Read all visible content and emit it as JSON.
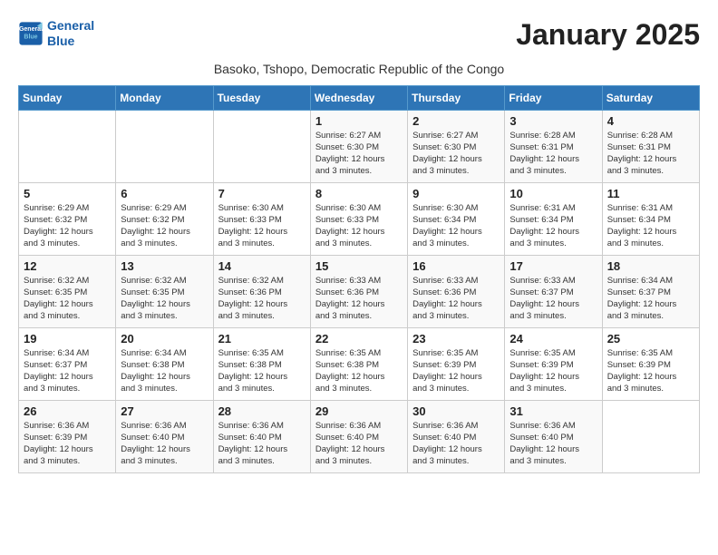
{
  "logo": {
    "line1": "General",
    "line2": "Blue"
  },
  "title": "January 2025",
  "subtitle": "Basoko, Tshopo, Democratic Republic of the Congo",
  "days_of_week": [
    "Sunday",
    "Monday",
    "Tuesday",
    "Wednesday",
    "Thursday",
    "Friday",
    "Saturday"
  ],
  "weeks": [
    [
      {
        "day": "",
        "info": ""
      },
      {
        "day": "",
        "info": ""
      },
      {
        "day": "",
        "info": ""
      },
      {
        "day": "1",
        "info": "Sunrise: 6:27 AM\nSunset: 6:30 PM\nDaylight: 12 hours\nand 3 minutes."
      },
      {
        "day": "2",
        "info": "Sunrise: 6:27 AM\nSunset: 6:30 PM\nDaylight: 12 hours\nand 3 minutes."
      },
      {
        "day": "3",
        "info": "Sunrise: 6:28 AM\nSunset: 6:31 PM\nDaylight: 12 hours\nand 3 minutes."
      },
      {
        "day": "4",
        "info": "Sunrise: 6:28 AM\nSunset: 6:31 PM\nDaylight: 12 hours\nand 3 minutes."
      }
    ],
    [
      {
        "day": "5",
        "info": "Sunrise: 6:29 AM\nSunset: 6:32 PM\nDaylight: 12 hours\nand 3 minutes."
      },
      {
        "day": "6",
        "info": "Sunrise: 6:29 AM\nSunset: 6:32 PM\nDaylight: 12 hours\nand 3 minutes."
      },
      {
        "day": "7",
        "info": "Sunrise: 6:30 AM\nSunset: 6:33 PM\nDaylight: 12 hours\nand 3 minutes."
      },
      {
        "day": "8",
        "info": "Sunrise: 6:30 AM\nSunset: 6:33 PM\nDaylight: 12 hours\nand 3 minutes."
      },
      {
        "day": "9",
        "info": "Sunrise: 6:30 AM\nSunset: 6:34 PM\nDaylight: 12 hours\nand 3 minutes."
      },
      {
        "day": "10",
        "info": "Sunrise: 6:31 AM\nSunset: 6:34 PM\nDaylight: 12 hours\nand 3 minutes."
      },
      {
        "day": "11",
        "info": "Sunrise: 6:31 AM\nSunset: 6:34 PM\nDaylight: 12 hours\nand 3 minutes."
      }
    ],
    [
      {
        "day": "12",
        "info": "Sunrise: 6:32 AM\nSunset: 6:35 PM\nDaylight: 12 hours\nand 3 minutes."
      },
      {
        "day": "13",
        "info": "Sunrise: 6:32 AM\nSunset: 6:35 PM\nDaylight: 12 hours\nand 3 minutes."
      },
      {
        "day": "14",
        "info": "Sunrise: 6:32 AM\nSunset: 6:36 PM\nDaylight: 12 hours\nand 3 minutes."
      },
      {
        "day": "15",
        "info": "Sunrise: 6:33 AM\nSunset: 6:36 PM\nDaylight: 12 hours\nand 3 minutes."
      },
      {
        "day": "16",
        "info": "Sunrise: 6:33 AM\nSunset: 6:36 PM\nDaylight: 12 hours\nand 3 minutes."
      },
      {
        "day": "17",
        "info": "Sunrise: 6:33 AM\nSunset: 6:37 PM\nDaylight: 12 hours\nand 3 minutes."
      },
      {
        "day": "18",
        "info": "Sunrise: 6:34 AM\nSunset: 6:37 PM\nDaylight: 12 hours\nand 3 minutes."
      }
    ],
    [
      {
        "day": "19",
        "info": "Sunrise: 6:34 AM\nSunset: 6:37 PM\nDaylight: 12 hours\nand 3 minutes."
      },
      {
        "day": "20",
        "info": "Sunrise: 6:34 AM\nSunset: 6:38 PM\nDaylight: 12 hours\nand 3 minutes."
      },
      {
        "day": "21",
        "info": "Sunrise: 6:35 AM\nSunset: 6:38 PM\nDaylight: 12 hours\nand 3 minutes."
      },
      {
        "day": "22",
        "info": "Sunrise: 6:35 AM\nSunset: 6:38 PM\nDaylight: 12 hours\nand 3 minutes."
      },
      {
        "day": "23",
        "info": "Sunrise: 6:35 AM\nSunset: 6:39 PM\nDaylight: 12 hours\nand 3 minutes."
      },
      {
        "day": "24",
        "info": "Sunrise: 6:35 AM\nSunset: 6:39 PM\nDaylight: 12 hours\nand 3 minutes."
      },
      {
        "day": "25",
        "info": "Sunrise: 6:35 AM\nSunset: 6:39 PM\nDaylight: 12 hours\nand 3 minutes."
      }
    ],
    [
      {
        "day": "26",
        "info": "Sunrise: 6:36 AM\nSunset: 6:39 PM\nDaylight: 12 hours\nand 3 minutes."
      },
      {
        "day": "27",
        "info": "Sunrise: 6:36 AM\nSunset: 6:40 PM\nDaylight: 12 hours\nand 3 minutes."
      },
      {
        "day": "28",
        "info": "Sunrise: 6:36 AM\nSunset: 6:40 PM\nDaylight: 12 hours\nand 3 minutes."
      },
      {
        "day": "29",
        "info": "Sunrise: 6:36 AM\nSunset: 6:40 PM\nDaylight: 12 hours\nand 3 minutes."
      },
      {
        "day": "30",
        "info": "Sunrise: 6:36 AM\nSunset: 6:40 PM\nDaylight: 12 hours\nand 3 minutes."
      },
      {
        "day": "31",
        "info": "Sunrise: 6:36 AM\nSunset: 6:40 PM\nDaylight: 12 hours\nand 3 minutes."
      },
      {
        "day": "",
        "info": ""
      }
    ]
  ]
}
